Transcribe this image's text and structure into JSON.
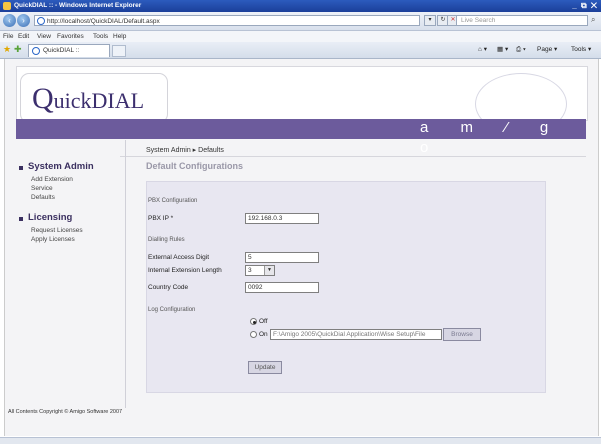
{
  "window": {
    "title": "QuickDIAL :: - Windows Internet Explorer",
    "controls": "_ ⧉ ✕"
  },
  "addressbar": {
    "url": "http://localhost/QuickDIAL/Default.aspx",
    "search_placeholder": "Live Search"
  },
  "menu": [
    "File",
    "Edit",
    "View",
    "Favorites",
    "Tools",
    "Help"
  ],
  "tab": {
    "label": "QuickDIAL ::"
  },
  "commandbar": {
    "page": "Page ▾",
    "tools": "Tools ▾"
  },
  "header": {
    "logo_initial": "Q",
    "logo_rest": "uickDIAL",
    "brand_letters": "a m ⁄ g o"
  },
  "breadcrumb": "System Admin ▸ Defaults",
  "page_title": "Default Configurations",
  "sidebar": {
    "system_admin": {
      "title": "System Admin",
      "items": [
        "Add Extension",
        "Service",
        "Defaults"
      ]
    },
    "licensing": {
      "title": "Licensing",
      "items": [
        "Request Licenses",
        "Apply Licenses"
      ]
    }
  },
  "form": {
    "pbx_group": "PBX Configuration",
    "pbx_ip_label": "PBX IP *",
    "pbx_ip_value": "192.168.0.3",
    "dialling_group": "Dialling Rules",
    "external_access_label": "External Access Digit",
    "external_access_value": "5",
    "internal_length_label": "Internal Extension Length",
    "internal_length_value": "3",
    "country_code_label": "Country Code",
    "country_code_value": "0092",
    "log_group": "Log Configuration",
    "log_off_label": "Off",
    "log_on_label": "On",
    "log_path_value": "F:\\Amigo 2005\\QuickDial Application\\Wise Setup\\File",
    "browse_label": "Browse",
    "update_label": "Update"
  },
  "footer": "All Contents Copyright © Amigo Software 2007",
  "colors": {
    "banner": "#6c5b9c",
    "logo": "#3c2f6e",
    "panel": "#e8e7f1"
  }
}
